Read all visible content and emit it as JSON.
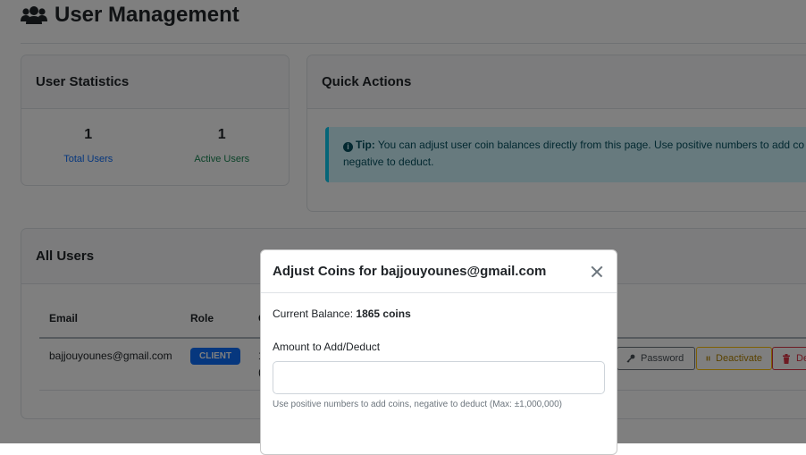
{
  "page": {
    "title": "User Management"
  },
  "stats": {
    "title": "User Statistics",
    "total_users": {
      "value": "1",
      "label": "Total Users"
    },
    "active_users": {
      "value": "1",
      "label": "Active Users"
    }
  },
  "quick_actions": {
    "title": "Quick Actions",
    "tip_label": "Tip:",
    "tip_line1": " You can adjust user coin balances directly from this page. Use positive numbers to add co",
    "tip_line2": "negative to deduct."
  },
  "users": {
    "title": "All Users",
    "columns": [
      "Email",
      "Role",
      "C"
    ],
    "rows": [
      {
        "email": "bajjouyounes@gmail.com",
        "role": "CLIENT",
        "coins_partial_1": "1",
        "coins_partial_2": "("
      }
    ],
    "actions": {
      "password": "Password",
      "deactivate": "Deactivate",
      "delete": "De"
    }
  },
  "modal": {
    "title": "Adjust Coins for bajjouyounes@gmail.com",
    "balance_label": "Current Balance:",
    "balance_value": "1865 coins",
    "amount_label": "Amount to Add/Deduct",
    "amount_value": "",
    "help_text": "Use positive numbers to add coins, negative to deduct (Max: ±1,000,000)"
  },
  "icons": [
    "users-icon",
    "info-icon",
    "key-icon",
    "pause-icon",
    "trash-icon",
    "close-icon"
  ],
  "colors": {
    "primary": "#0d6efd",
    "success": "#198754",
    "info_bg": "#cff4fc",
    "warning": "#ffc107",
    "danger": "#dc3545"
  }
}
